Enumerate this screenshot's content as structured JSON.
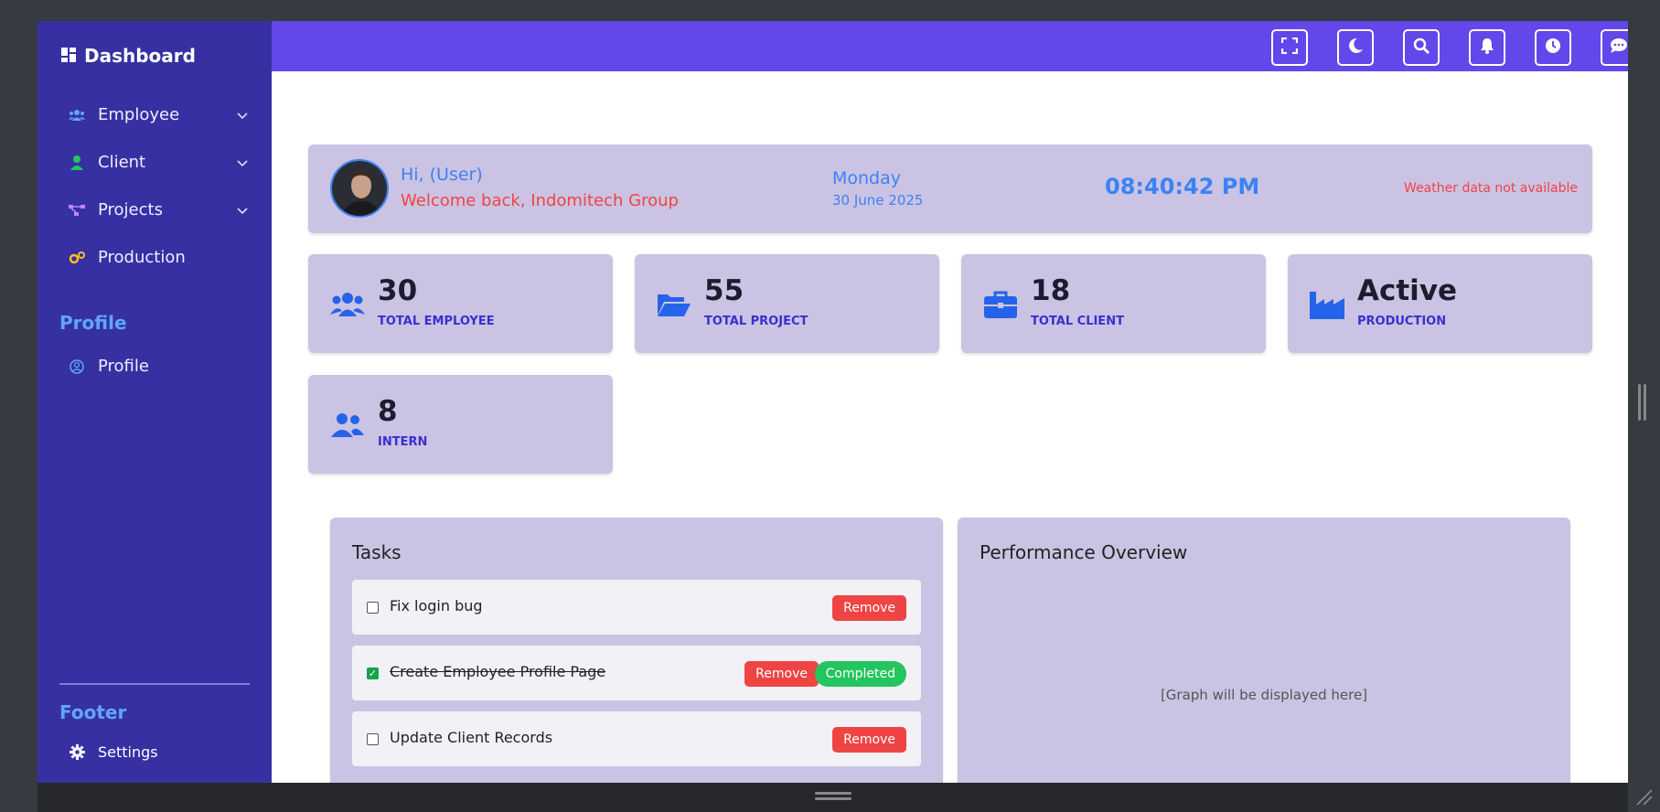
{
  "sidebar": {
    "brand": "Dashboard",
    "items": [
      {
        "label": "Employee",
        "icon": "users-icon"
      },
      {
        "label": "Client",
        "icon": "user-icon"
      },
      {
        "label": "Projects",
        "icon": "project-diagram-icon"
      },
      {
        "label": "Production",
        "icon": "cogs-icon"
      }
    ],
    "profile_section": "Profile",
    "profile_item": "Profile",
    "footer_section": "Footer",
    "settings_item": "Settings"
  },
  "topbar": {
    "buttons": [
      "fullscreen-icon",
      "moon-icon",
      "search-icon",
      "bell-icon",
      "clock-icon",
      "chat-icon"
    ]
  },
  "welcome": {
    "greeting": "Hi, (User)",
    "message": "Welcome back, Indomitech Group",
    "day": "Monday",
    "date": "30 June 2025",
    "time": "08:40:42 PM",
    "weather": "Weather data not available"
  },
  "stats": [
    {
      "value": "30",
      "label": "TOTAL EMPLOYEE",
      "icon": "users-icon"
    },
    {
      "value": "55",
      "label": "TOTAL PROJECT",
      "icon": "folder-open-icon"
    },
    {
      "value": "18",
      "label": "TOTAL CLIENT",
      "icon": "briefcase-icon"
    },
    {
      "value": "Active",
      "label": "PRODUCTION",
      "icon": "industry-icon"
    },
    {
      "value": "8",
      "label": "INTERN",
      "icon": "user-friends-icon"
    }
  ],
  "tasks": {
    "title": "Tasks",
    "items": [
      {
        "text": "Fix login bug",
        "checked": false,
        "remove_label": "Remove"
      },
      {
        "text": "Create Employee Profile Page",
        "checked": true,
        "remove_label": "Remove",
        "status": "Completed"
      },
      {
        "text": "Update Client Records",
        "checked": false,
        "remove_label": "Remove"
      }
    ]
  },
  "performance": {
    "title": "Performance Overview",
    "placeholder": "[Graph will be displayed here]"
  },
  "colors": {
    "sidebar": "#3730a3",
    "topbar": "#6347ea",
    "card": "#cbc3e3",
    "accent": "#3b82f6",
    "danger": "#ef4444",
    "success": "#22c55e"
  }
}
